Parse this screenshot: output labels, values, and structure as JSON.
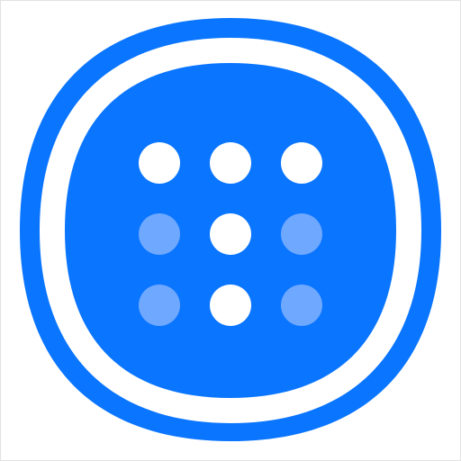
{
  "app_icon": {
    "name": "dot-pattern-launcher-icon",
    "colors": {
      "background": "#ffffff",
      "outer_ring": "#0a75ff",
      "gap_ring": "#ffffff",
      "inner_tile": "#0a75ff",
      "dot_primary": "#ffffff",
      "dot_muted": "#6ea8ff",
      "frame_border": "#e2e2e2"
    },
    "dot_grid": {
      "rows": 3,
      "cols": 3,
      "pattern": [
        [
          "bright",
          "bright",
          "bright"
        ],
        [
          "muted",
          "bright",
          "muted"
        ],
        [
          "muted",
          "bright",
          "muted"
        ]
      ]
    }
  }
}
